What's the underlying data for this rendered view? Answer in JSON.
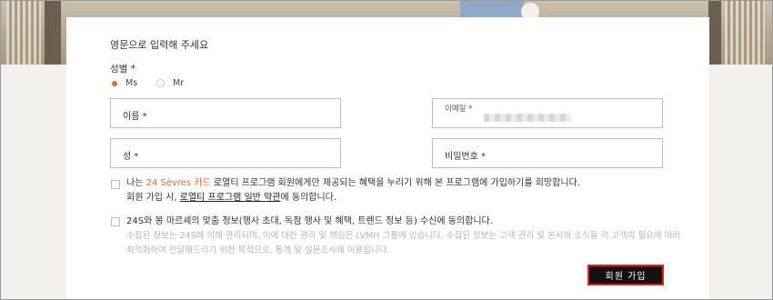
{
  "form": {
    "title": "영문으로 입력해 주세요",
    "gender": {
      "label": "성별 *",
      "options": [
        "Ms",
        "Mr"
      ],
      "selected": "Ms"
    },
    "fields": {
      "first_name": "이름 *",
      "email": "이메일 *",
      "last_name": "성 *",
      "password": "비밀번호 *"
    },
    "consent_loyalty": {
      "text_before": "나는 ",
      "card_name": "24 Sèvres 카드",
      "text_after": " 로열티 프로그램 회원에게만 제공되는 혜택을 누리기 위해 본 프로그램에 가입하기를 희망합니다.",
      "line2_before": "회원 가입 시, ",
      "terms_link": "로열티 프로그램 일반 약관",
      "line2_after": "에 동의합니다."
    },
    "consent_marketing": {
      "text": "24S와 봉 마르셰의 맞춤 정보(행사 초대, 독점 행사 및 혜택, 트렌드 정보 등) 수신에 동의합니다.",
      "subtext": "수집된 정보는 24S에 의해 관리되며, 이에 대한 관리 및 책임은 LVMH 그룹에 있습니다. 수집된 정보는 고객 관리 및 본사의 소식을 각 고객의 필요에 따라 최적화하여 전달해드리기 위한 목적으로, 통계 및 설문조사에 이용됩니다."
    },
    "submit_label": "회원 가입"
  },
  "colors": {
    "accent": "#e0683a",
    "button_bg": "#111111",
    "button_border": "#e02020"
  }
}
